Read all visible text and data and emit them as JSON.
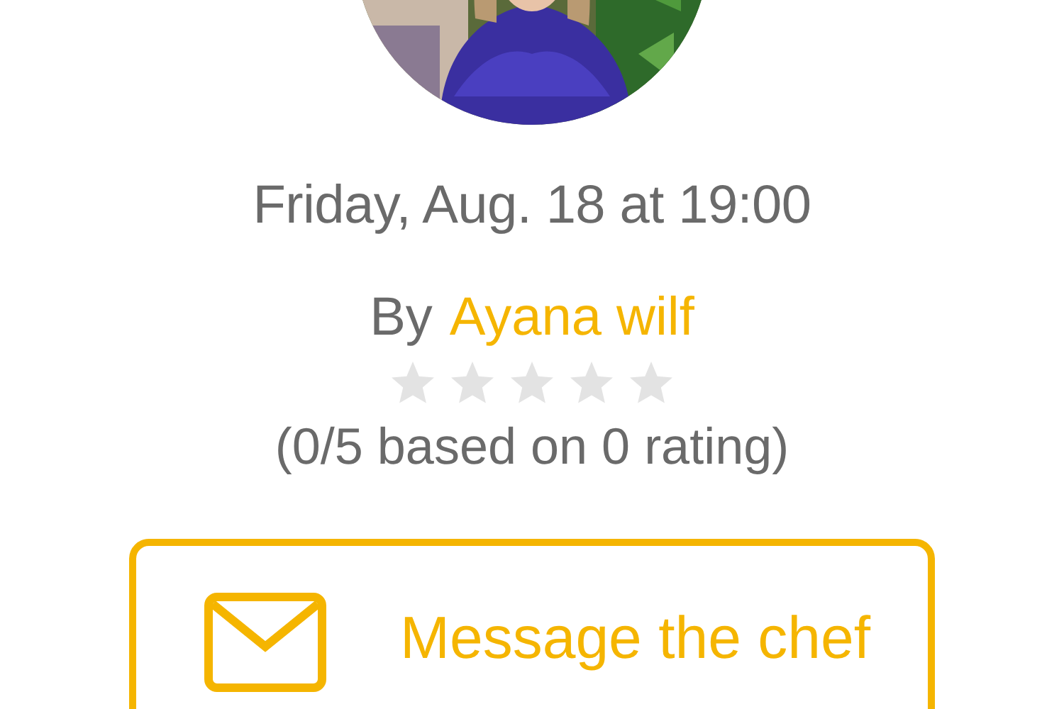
{
  "date": "Friday, Aug. 18 at 19:00",
  "host": {
    "prefix": "By",
    "name": "Ayana wilf"
  },
  "rating": {
    "stars": 0,
    "text": "(0/5 based on 0 rating)"
  },
  "message_button": {
    "label": "Message the chef"
  }
}
